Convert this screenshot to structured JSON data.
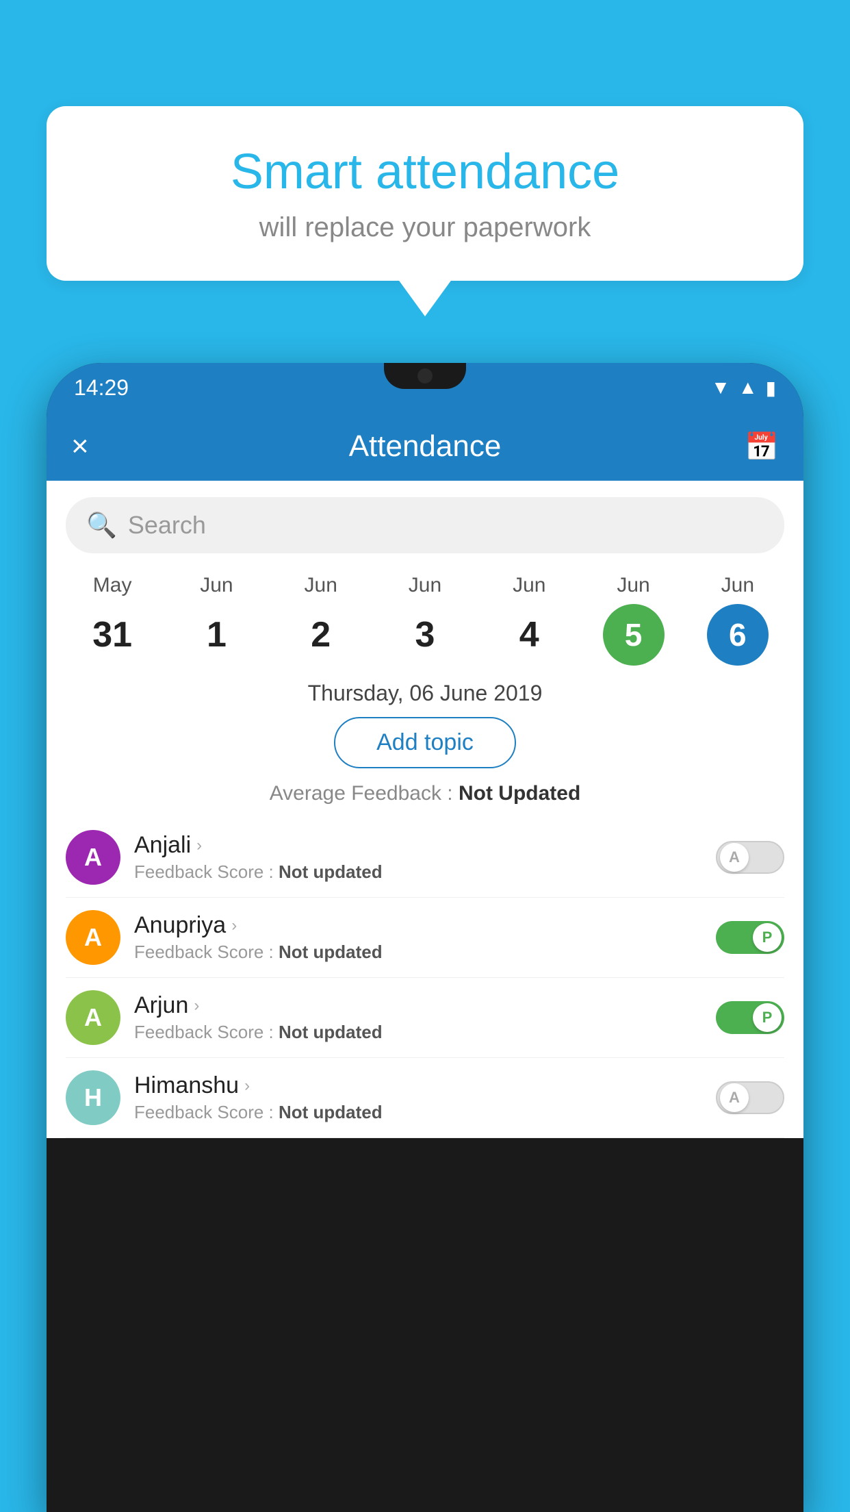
{
  "background_color": "#29b6e8",
  "bubble": {
    "title": "Smart attendance",
    "subtitle": "will replace your paperwork"
  },
  "status_bar": {
    "time": "14:29",
    "icons": [
      "wifi",
      "signal",
      "battery"
    ]
  },
  "app_bar": {
    "title": "Attendance",
    "close_label": "×",
    "calendar_icon": "calendar-icon"
  },
  "search": {
    "placeholder": "Search"
  },
  "calendar": {
    "days": [
      {
        "month": "May",
        "date": "31",
        "state": "normal"
      },
      {
        "month": "Jun",
        "date": "1",
        "state": "normal"
      },
      {
        "month": "Jun",
        "date": "2",
        "state": "normal"
      },
      {
        "month": "Jun",
        "date": "3",
        "state": "normal"
      },
      {
        "month": "Jun",
        "date": "4",
        "state": "normal"
      },
      {
        "month": "Jun",
        "date": "5",
        "state": "today"
      },
      {
        "month": "Jun",
        "date": "6",
        "state": "selected"
      }
    ]
  },
  "selected_date_label": "Thursday, 06 June 2019",
  "add_topic_label": "Add topic",
  "avg_feedback": {
    "label": "Average Feedback :",
    "value": "Not Updated"
  },
  "students": [
    {
      "name": "Anjali",
      "avatar_letter": "A",
      "avatar_color": "purple",
      "feedback_label": "Feedback Score :",
      "feedback_value": "Not updated",
      "toggle_state": "off",
      "toggle_label": "A"
    },
    {
      "name": "Anupriya",
      "avatar_letter": "A",
      "avatar_color": "orange",
      "feedback_label": "Feedback Score :",
      "feedback_value": "Not updated",
      "toggle_state": "on",
      "toggle_label": "P"
    },
    {
      "name": "Arjun",
      "avatar_letter": "A",
      "avatar_color": "green",
      "feedback_label": "Feedback Score :",
      "feedback_value": "Not updated",
      "toggle_state": "on",
      "toggle_label": "P"
    },
    {
      "name": "Himanshu",
      "avatar_letter": "H",
      "avatar_color": "teal",
      "feedback_label": "Feedback Score :",
      "feedback_value": "Not updated",
      "toggle_state": "off",
      "toggle_label": "A"
    }
  ]
}
